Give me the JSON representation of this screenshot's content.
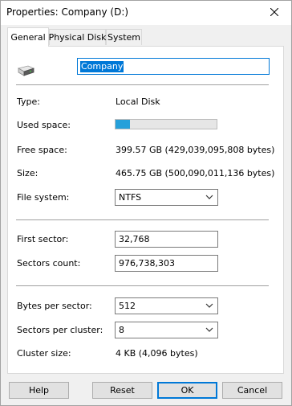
{
  "window": {
    "title": "Properties: Company (D:)"
  },
  "tabs": [
    {
      "label": "General",
      "active": true
    },
    {
      "label": "Physical Disk",
      "active": false
    },
    {
      "label": "System",
      "active": false
    }
  ],
  "general": {
    "drive_name": "Company",
    "type_label": "Type:",
    "type_value": "Local Disk",
    "used_label": "Used space:",
    "used_fraction": 0.141,
    "free_label": "Free space:",
    "free_value": "399.57 GB (429,039,095,808 bytes)",
    "size_label": "Size:",
    "size_value": "465.75 GB (500,090,011,136 bytes)",
    "fs_label": "File system:",
    "fs_value": "NTFS",
    "first_sector_label": "First sector:",
    "first_sector_value": "32,768",
    "sectors_count_label": "Sectors count:",
    "sectors_count_value": "976,738,303",
    "bytes_per_sector_label": "Bytes per sector:",
    "bytes_per_sector_value": "512",
    "sectors_per_cluster_label": "Sectors per cluster:",
    "sectors_per_cluster_value": "8",
    "cluster_size_label": "Cluster size:",
    "cluster_size_value": "4 KB (4,096 bytes)"
  },
  "buttons": {
    "help": "Help",
    "reset": "Reset",
    "ok": "OK",
    "cancel": "Cancel"
  },
  "colors": {
    "accent": "#0078d7",
    "usage_fill": "#26a0da"
  }
}
